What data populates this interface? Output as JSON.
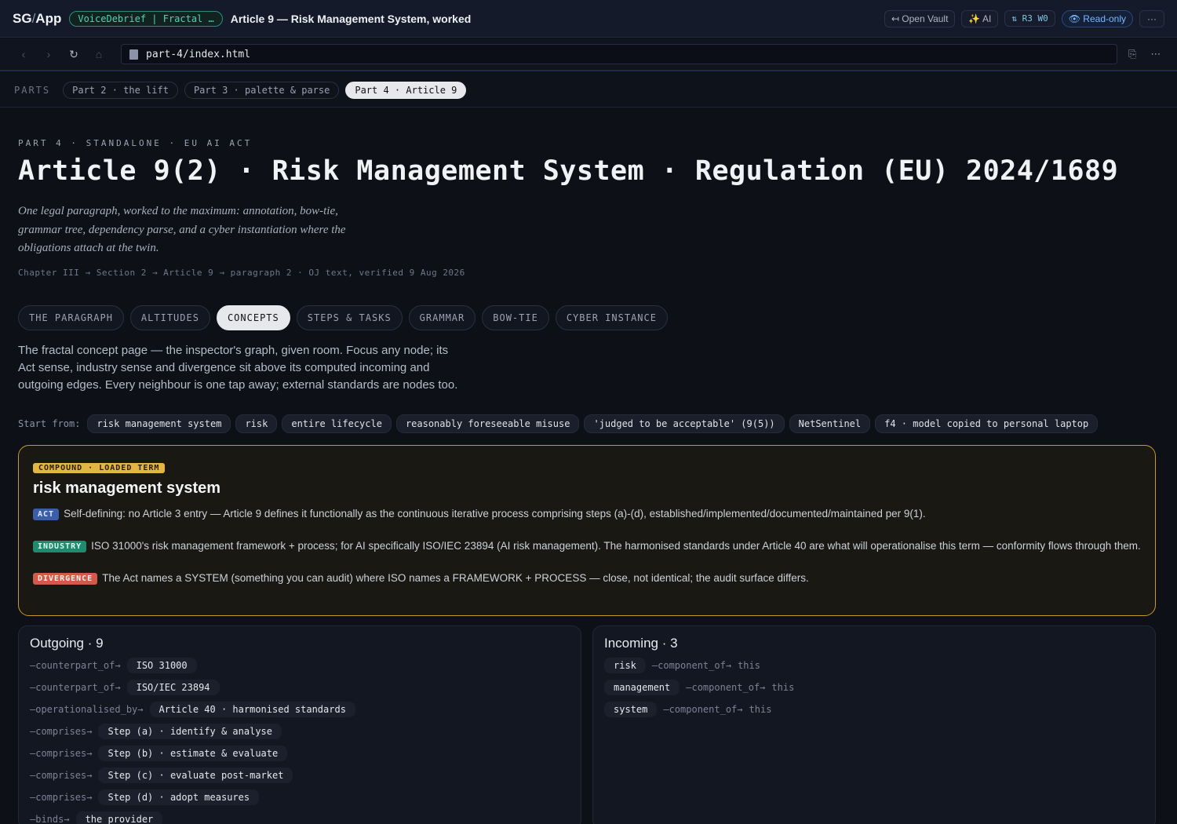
{
  "app": {
    "logo_main": "SG",
    "logo_slash": "/",
    "logo_app": "App",
    "breadcrumb_pill": "VoiceDebrief | Fractal …",
    "window_title": "Article 9 — Risk Management System, worked",
    "actions": {
      "open_vault": "↤ Open Vault",
      "ai": "✨ AI",
      "revision": "⇅ R3 W0",
      "readonly": "👁 Read-only",
      "more": "···"
    }
  },
  "navbar": {
    "back": "‹",
    "forward": "›",
    "reload": "↻",
    "home": "⌂",
    "url": "part-4/index.html",
    "copy": "⎘",
    "more": "⋯"
  },
  "parts": {
    "label": "PARTS",
    "tabs": [
      "Part 2 · the lift",
      "Part 3 · palette & parse",
      "Part 4 · Article 9"
    ],
    "active_index": 2
  },
  "page": {
    "eyebrow": "PART 4 · STANDALONE · EU AI ACT",
    "title": "Article 9(2) · Risk Management System · Regulation (EU) 2024/1689",
    "lede": "One legal paragraph, worked to the maximum: annotation, bow-tie, grammar tree, dependency parse, and a cyber instantiation where the obligations attach at the twin.",
    "citation": "Chapter III → Section 2 → Article 9 → paragraph 2 · OJ text, verified 9 Aug 2026",
    "tabs": [
      "THE PARAGRAPH",
      "ALTITUDES",
      "CONCEPTS",
      "STEPS & TASKS",
      "GRAMMAR",
      "BOW-TIE",
      "CYBER INSTANCE"
    ],
    "active_tab": 2,
    "intro": "The fractal concept page — the inspector's graph, given room. Focus any node; its Act sense, industry sense and divergence sit above its computed incoming and outgoing edges. Every neighbour is one tap away; external standards are nodes too.",
    "start_from_label": "Start from:",
    "start_nodes": [
      "risk management system",
      "risk",
      "entire lifecycle",
      "reasonably foreseeable misuse",
      "'judged to be acceptable' (9(5))",
      "NetSentinel",
      "f4 · model copied to personal laptop"
    ]
  },
  "focus": {
    "badge": "COMPOUND · LOADED TERM",
    "title": "risk management system",
    "senses": [
      {
        "tag": "ACT",
        "text": "Self-defining: no Article 3 entry — Article 9 defines it functionally as the continuous iterative process comprising steps (a)-(d), established/implemented/documented/maintained per 9(1)."
      },
      {
        "tag": "INDUSTRY",
        "text": "ISO 31000's risk management framework + process; for AI specifically ISO/IEC 23894 (AI risk management). The harmonised standards under Article 40 are what will operationalise this term — conformity flows through them."
      },
      {
        "tag": "DIVERGENCE",
        "text": "The Act names a SYSTEM (something you can audit) where ISO names a FRAMEWORK + PROCESS — close, not identical; the audit surface differs."
      }
    ]
  },
  "outgoing": {
    "title": "Outgoing · 9",
    "edges": [
      {
        "rel": "—counterpart_of→",
        "target": "ISO 31000"
      },
      {
        "rel": "—counterpart_of→",
        "target": "ISO/IEC 23894"
      },
      {
        "rel": "—operationalised_by→",
        "target": "Article 40 · harmonised standards"
      },
      {
        "rel": "—comprises→",
        "target": "Step (a) · identify & analyse"
      },
      {
        "rel": "—comprises→",
        "target": "Step (b) · estimate & evaluate"
      },
      {
        "rel": "—comprises→",
        "target": "Step (c) · evaluate post-market"
      },
      {
        "rel": "—comprises→",
        "target": "Step (d) · adopt measures"
      },
      {
        "rel": "—binds→",
        "target": "the provider"
      }
    ]
  },
  "incoming": {
    "title": "Incoming · 3",
    "edges": [
      {
        "source": "risk",
        "rel": "—component_of→",
        "this": "this"
      },
      {
        "source": "management",
        "rel": "—component_of→",
        "this": "this"
      },
      {
        "source": "system",
        "rel": "—component_of→",
        "this": "this"
      }
    ]
  }
}
